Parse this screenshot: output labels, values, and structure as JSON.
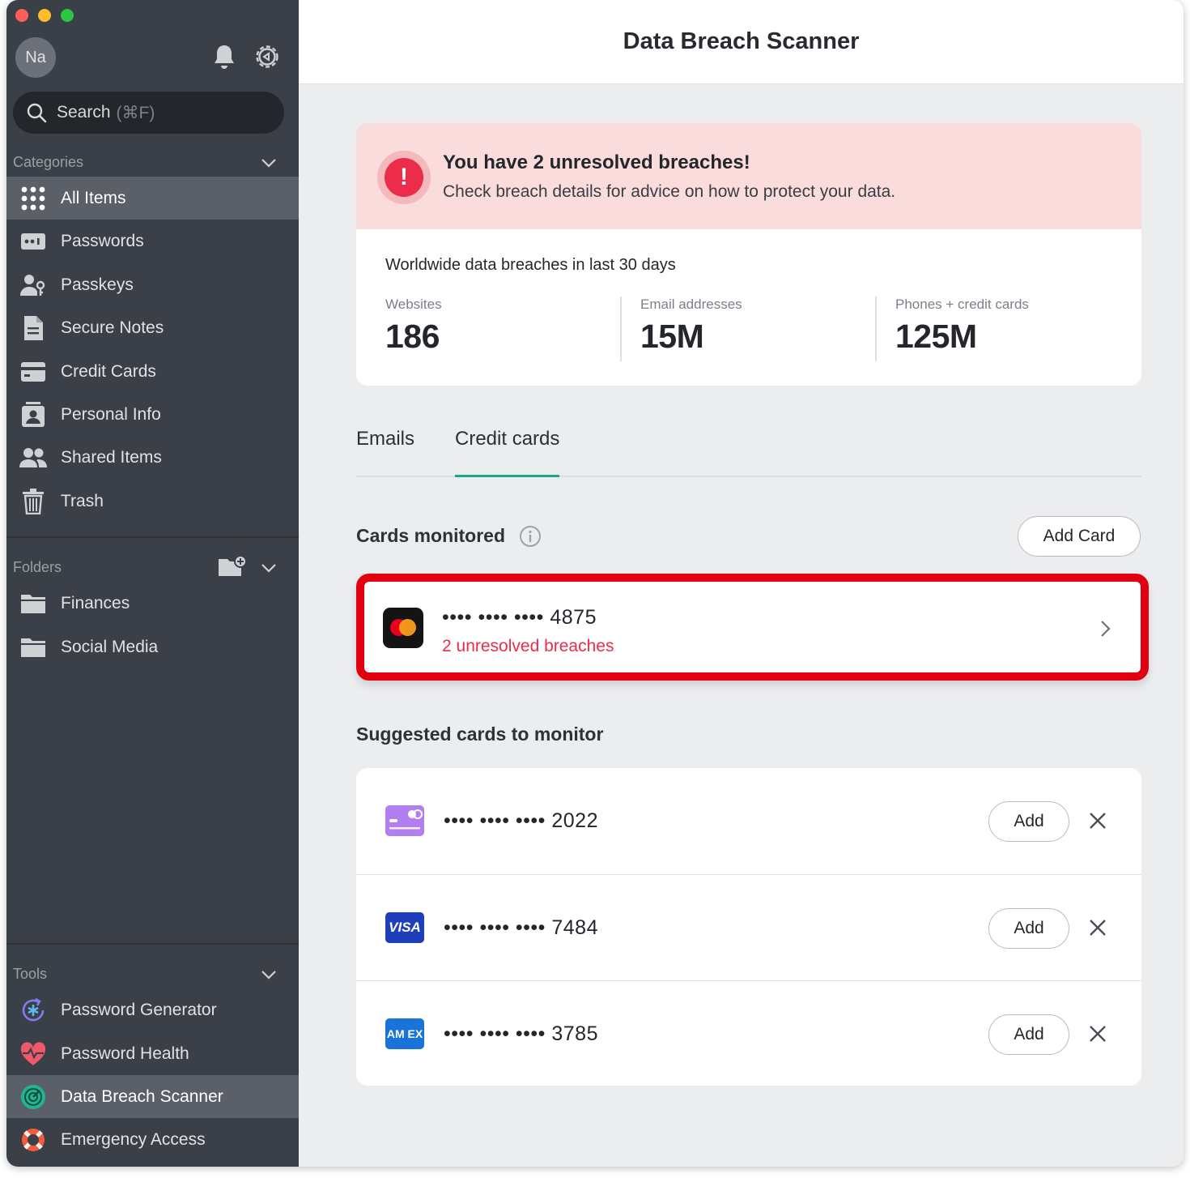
{
  "window": {
    "title": "Data Breach Scanner"
  },
  "sidebar": {
    "avatar_initials": "Na",
    "search": {
      "label": "Search",
      "shortcut": "(⌘F)"
    },
    "categories_label": "Categories",
    "categories": [
      {
        "label": "All Items",
        "icon": "grid-icon",
        "active": true
      },
      {
        "label": "Passwords",
        "icon": "password-icon"
      },
      {
        "label": "Passkeys",
        "icon": "passkey-icon"
      },
      {
        "label": "Secure Notes",
        "icon": "note-icon"
      },
      {
        "label": "Credit Cards",
        "icon": "credit-card-icon"
      },
      {
        "label": "Personal Info",
        "icon": "id-badge-icon"
      },
      {
        "label": "Shared Items",
        "icon": "people-icon"
      },
      {
        "label": "Trash",
        "icon": "trash-icon"
      }
    ],
    "folders_label": "Folders",
    "folders": [
      {
        "label": "Finances",
        "icon": "folder-icon"
      },
      {
        "label": "Social Media",
        "icon": "folder-icon"
      }
    ],
    "tools_label": "Tools",
    "tools": [
      {
        "label": "Password Generator",
        "icon": "generator-icon"
      },
      {
        "label": "Password Health",
        "icon": "heart-pulse-icon"
      },
      {
        "label": "Data Breach Scanner",
        "icon": "radar-icon",
        "active": true
      },
      {
        "label": "Emergency Access",
        "icon": "lifebuoy-icon"
      }
    ]
  },
  "alert": {
    "title": "You have 2 unresolved breaches!",
    "subtitle": "Check breach details for advice on how to protect your data.",
    "icon": "!"
  },
  "stats": {
    "title": "Worldwide data breaches in last 30 days",
    "items": [
      {
        "label": "Websites",
        "value": "186"
      },
      {
        "label": "Email addresses",
        "value": "15M"
      },
      {
        "label": "Phones + credit cards",
        "value": "125M"
      }
    ]
  },
  "tabs": [
    {
      "label": "Emails",
      "active": false
    },
    {
      "label": "Credit cards",
      "active": true
    }
  ],
  "monitored": {
    "title": "Cards monitored",
    "add_button": "Add Card",
    "card": {
      "number": "•••• •••• •••• 4875",
      "status": "2 unresolved breaches",
      "brand": "mastercard"
    }
  },
  "suggested": {
    "title": "Suggested cards to monitor",
    "cards": [
      {
        "number": "•••• •••• •••• 2022",
        "brand": "generic",
        "add_label": "Add"
      },
      {
        "number": "•••• •••• •••• 7484",
        "brand": "visa",
        "brand_text": "VISA",
        "add_label": "Add"
      },
      {
        "number": "•••• •••• •••• 3785",
        "brand": "amex",
        "brand_text": "AM EX",
        "add_label": "Add"
      }
    ]
  },
  "colors": {
    "sidebar_bg": "#3b3f47",
    "active_bg": "#5b5f67",
    "alert_bg": "#f9dcdb",
    "danger": "#ec2c4a",
    "accent_tab": "#1aa98e",
    "highlight_border": "#e0000f"
  }
}
